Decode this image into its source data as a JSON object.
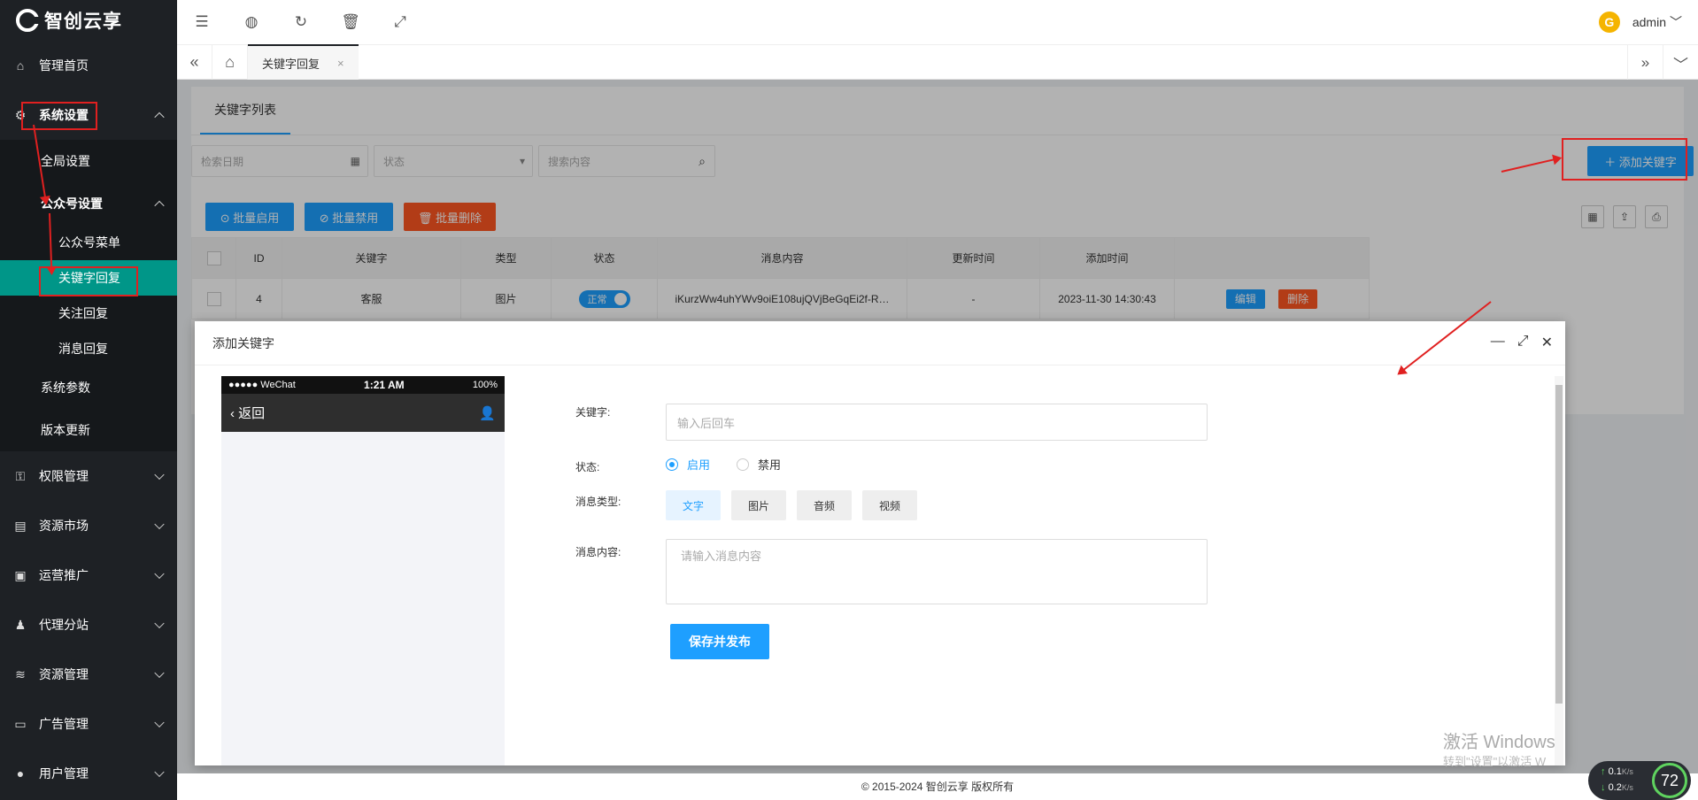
{
  "brand": {
    "name": "智创云享"
  },
  "sidebar": {
    "items": [
      {
        "label": "管理首页",
        "icon": "home-icon"
      },
      {
        "label": "系统设置",
        "icon": "gear-icon"
      },
      {
        "label": "全局设置"
      },
      {
        "label": "公众号设置"
      },
      {
        "label": "公众号菜单"
      },
      {
        "label": "关键字回复"
      },
      {
        "label": "关注回复"
      },
      {
        "label": "消息回复"
      },
      {
        "label": "系统参数"
      },
      {
        "label": "版本更新"
      },
      {
        "label": "权限管理",
        "icon": "user-key-icon"
      },
      {
        "label": "资源市场",
        "icon": "store-icon"
      },
      {
        "label": "运营推广",
        "icon": "promote-icon"
      },
      {
        "label": "代理分站",
        "icon": "agent-icon"
      },
      {
        "label": "资源管理",
        "icon": "layers-icon"
      },
      {
        "label": "广告管理",
        "icon": "ad-icon"
      },
      {
        "label": "用户管理",
        "icon": "user-icon"
      }
    ]
  },
  "topbar": {
    "user": "admin"
  },
  "tabs": {
    "active": "关键字回复",
    "close": "×"
  },
  "page": {
    "card_tab": "关键字列表",
    "filters": {
      "date_placeholder": "检索日期",
      "status_placeholder": "状态",
      "search_placeholder": "搜索内容"
    },
    "add_button": "＋ 添加关键字",
    "bulk": {
      "enable": "⊙ 批量启用",
      "disable": "⊘ 批量禁用",
      "delete": "🗑 批量删除"
    },
    "table": {
      "headers": [
        "ID",
        "关键字",
        "类型",
        "状态",
        "消息内容",
        "更新时间",
        "添加时间"
      ],
      "rows": [
        {
          "id": "4",
          "keyword": "客服",
          "type": "图片",
          "status": "正常",
          "content": "iKurzWw4uhYWv9oiE108ujQVjBeGqEi2f-R…",
          "updated": "-",
          "added": "2023-11-30 14:30:43",
          "edit": "编辑",
          "del": "删除"
        }
      ]
    }
  },
  "modal": {
    "title": "添加关键字",
    "phone": {
      "carrier": "●●●●● WeChat",
      "time": "1:21 AM",
      "battery": "100%",
      "back": "返回"
    },
    "form": {
      "keyword_label": "关键字:",
      "keyword_placeholder": "输入后回车",
      "status_label": "状态:",
      "status_on": "启用",
      "status_off": "禁用",
      "type_label": "消息类型:",
      "types": [
        "文字",
        "图片",
        "音频",
        "视频"
      ],
      "content_label": "消息内容:",
      "content_placeholder": "请输入消息内容",
      "submit": "保存并发布"
    }
  },
  "footer": {
    "text": "© 2015-2024 智创云享 版权所有"
  },
  "watermark": {
    "line1": "激活 Windows",
    "line2": "转到\"设置\"以激活 W"
  },
  "net": {
    "up": "0.1",
    "down": "0.2",
    "unit": "K/s",
    "percent": "72"
  },
  "colors": {
    "accent": "#1e9fff",
    "sidebar": "#1e2125",
    "active": "#009688",
    "danger": "#ff5722",
    "annotation": "#e02020"
  }
}
